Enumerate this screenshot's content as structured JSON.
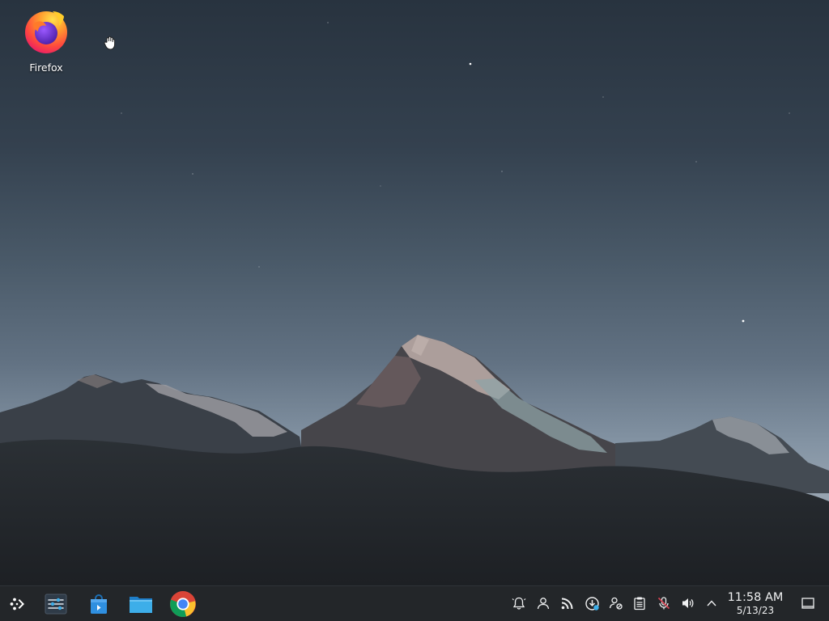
{
  "desktop": {
    "icons": [
      {
        "label": "Firefox",
        "icon": "firefox-icon"
      }
    ],
    "pointer": "grab-hand-cursor"
  },
  "taskbar": {
    "launcher": {
      "icon": "application-launcher-icon"
    },
    "pinned": [
      {
        "name": "System Settings",
        "icon": "settings-sliders-icon"
      },
      {
        "name": "Discover",
        "icon": "software-store-icon"
      },
      {
        "name": "Dolphin",
        "icon": "folder-icon"
      },
      {
        "name": "Google Chrome",
        "icon": "chrome-icon"
      }
    ],
    "tray": [
      {
        "name": "notifications",
        "icon": "bell-icon"
      },
      {
        "name": "user",
        "icon": "person-icon"
      },
      {
        "name": "network",
        "icon": "rss-icon"
      },
      {
        "name": "updates",
        "icon": "updates-icon"
      },
      {
        "name": "kde-connect",
        "icon": "user-settings-icon"
      },
      {
        "name": "clipboard",
        "icon": "clipboard-icon"
      },
      {
        "name": "microphone",
        "icon": "mic-muted-icon"
      },
      {
        "name": "volume",
        "icon": "speaker-icon"
      },
      {
        "name": "expand",
        "icon": "chevron-up-icon"
      }
    ],
    "clock": {
      "time": "11:58 AM",
      "date": "5/13/23"
    },
    "show_desktop": {
      "icon": "show-desktop-icon"
    }
  }
}
